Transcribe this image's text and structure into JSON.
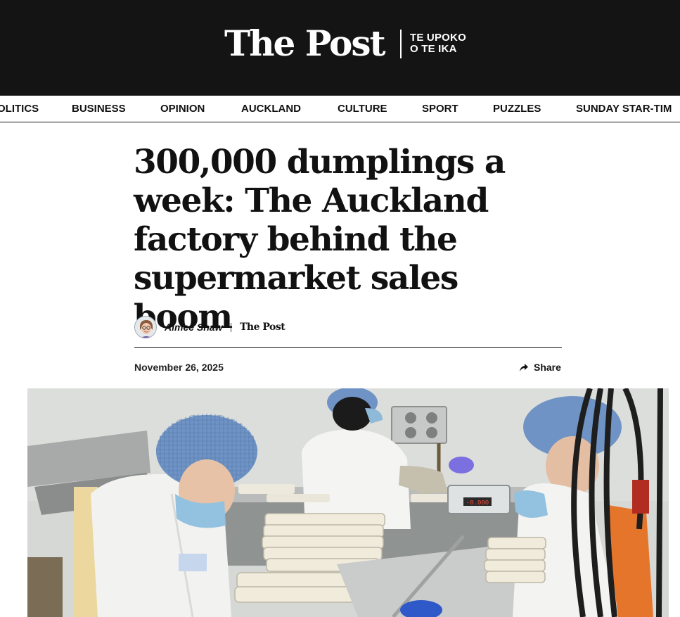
{
  "masthead": {
    "logo": "The Post",
    "logo_sub_line1": "TE UPOKO",
    "logo_sub_line2": "O TE IKA"
  },
  "nav": {
    "items": [
      "OLITICS",
      "BUSINESS",
      "OPINION",
      "AUCKLAND",
      "CULTURE",
      "SPORT",
      "PUZZLES",
      "SUNDAY STAR-TIM"
    ]
  },
  "article": {
    "headline": "300,000 dumplings a week: The Auckland factory behind the supermarket sales boom",
    "author": "Aimee Shaw",
    "publication": "The Post",
    "date": "November 26, 2025",
    "share_label": "Share",
    "scale_display": "-0.000"
  },
  "icons": {
    "share": "share-arrow-icon",
    "avatar": "author-avatar"
  },
  "colors": {
    "masthead_bg": "#141414",
    "text": "#111111",
    "hairnet": "#6f93c4",
    "glove": "#7c6fe0"
  }
}
